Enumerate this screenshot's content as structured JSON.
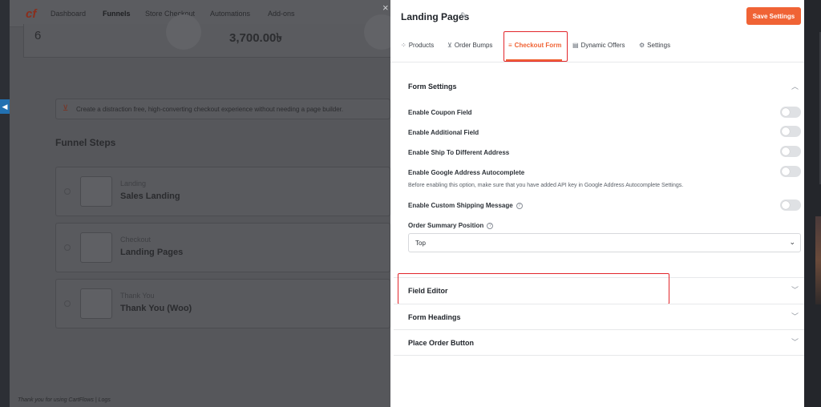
{
  "background_app": {
    "nav": [
      "Dashboard",
      "Funnels",
      "Store Checkout",
      "Automations",
      "Add-ons"
    ],
    "stats": [
      "6",
      "3,700.00৳"
    ],
    "banner_text": "Create a distraction free, high-converting checkout experience without needing a page builder.",
    "section_title": "Funnel Steps",
    "steps": [
      {
        "type": "Landing",
        "name": "Sales Landing"
      },
      {
        "type": "Checkout",
        "name": "Landing Pages"
      },
      {
        "type": "Thank You",
        "name": "Thank You (Woo)"
      }
    ],
    "footer": "Thank you for using CartFlows | Logs"
  },
  "panel": {
    "title": "Landing Pages",
    "save_label": "Save Settings",
    "tabs": [
      {
        "label": "Products",
        "icon": "products-icon"
      },
      {
        "label": "Order Bumps",
        "icon": "cart-icon"
      },
      {
        "label": "Checkout Form",
        "icon": "list-icon"
      },
      {
        "label": "Dynamic Offers",
        "icon": "database-icon"
      },
      {
        "label": "Settings",
        "icon": "gear-icon"
      }
    ],
    "active_tab": "Checkout Form",
    "form_settings": {
      "title": "Form Settings",
      "toggles": [
        {
          "label": "Enable Coupon Field",
          "on": false
        },
        {
          "label": "Enable Additional Field",
          "on": false
        },
        {
          "label": "Enable Ship To Different Address",
          "on": false
        },
        {
          "label": "Enable Google Address Autocomplete",
          "on": false
        }
      ],
      "autocomplete_note": "Before enabling this option, make sure that you have added API key in Google Address Autocomplete Settings.",
      "shipping_message_label": "Enable Custom Shipping Message",
      "shipping_message_on": false,
      "order_summary_label": "Order Summary Position",
      "order_summary_value": "Top"
    },
    "accordions": [
      {
        "title": "Field Editor"
      },
      {
        "title": "Form Headings"
      },
      {
        "title": "Place Order Button"
      }
    ]
  },
  "colors": {
    "accent": "#f06335",
    "highlight": "#e2262b"
  }
}
